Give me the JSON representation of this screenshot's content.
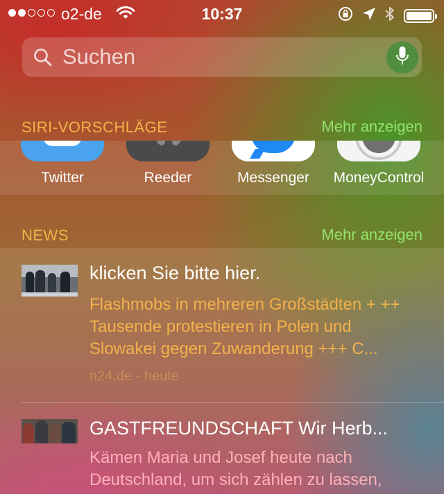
{
  "status_bar": {
    "signal_dots_filled": 2,
    "signal_dots_total": 5,
    "carrier": "o2-de",
    "time": "10:37",
    "battery_level": 0.95,
    "icons": [
      "wifi-icon",
      "rotation-lock-icon",
      "location-arrow-icon",
      "bluetooth-icon",
      "battery-icon"
    ]
  },
  "search": {
    "placeholder": "Suchen",
    "value": "",
    "icons": [
      "search-icon",
      "microphone-icon"
    ]
  },
  "siri_suggestions": {
    "title": "SIRI-VORSCHLÄGE",
    "more_label": "Mehr anzeigen",
    "apps": [
      {
        "label": "Twitter",
        "icon": "twitter-app-icon",
        "color": "#4aa3ef"
      },
      {
        "label": "Reeder",
        "icon": "reeder-app-icon",
        "color": "#4a4a4a"
      },
      {
        "label": "Messenger",
        "icon": "messenger-app-icon",
        "color": "#ffffff"
      },
      {
        "label": "MoneyControl",
        "icon": "moneycontrol-app-icon",
        "color": "#f4f4f4"
      }
    ]
  },
  "news": {
    "title": "NEWS",
    "more_label": "Mehr anzeigen",
    "items": [
      {
        "headline": "klicken Sie bitte hier.",
        "summary": "Flashmobs in mehreren Großstädten + ++ Tausende protestieren in Polen und Slowakei gegen Zuwanderung +++ C...",
        "source": "n24.de - heute"
      },
      {
        "headline": "GASTFREUNDSCHAFT Wir Herb...",
        "summary": "Kämen Maria und Josef heute nach Deutschland, um sich zählen zu lassen,",
        "source": ""
      }
    ]
  },
  "colors": {
    "section_title": "#f2b24a",
    "more_link": "#93e36a",
    "news_summary_1": "#f2b24a",
    "news_summary_2": "#ffb0b8"
  }
}
